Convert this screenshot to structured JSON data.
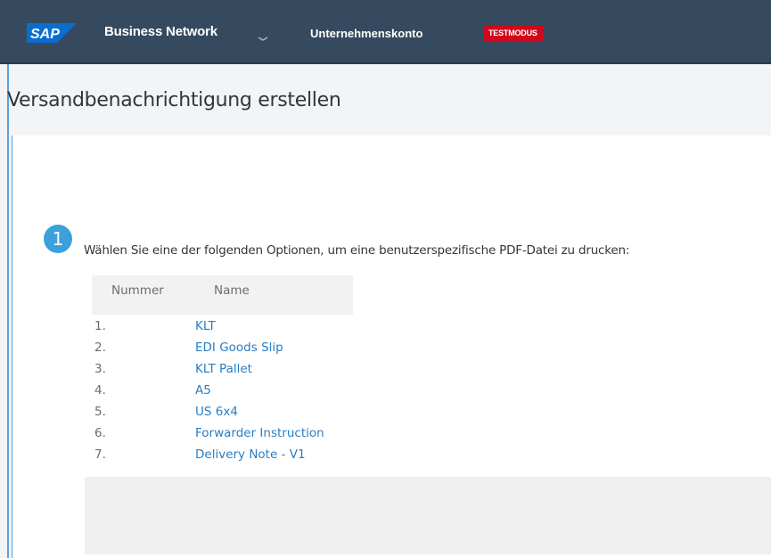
{
  "header": {
    "logo_text": "SAP",
    "app_name": "Business Network",
    "account_label": "Unternehmenskonto",
    "mode_badge": "TESTMODUS",
    "colors": {
      "bar": "#354a5f",
      "badge": "#d0081c",
      "logo": "#0a6ed1"
    }
  },
  "page": {
    "title": "Versandbenachrichtigung erstellen"
  },
  "step": {
    "number": "1",
    "instruction": "Wählen Sie eine der folgenden Optionen, um eine benutzerspezifische PDF-Datei zu drucken:"
  },
  "table": {
    "columns": [
      "Nummer",
      "Name"
    ],
    "rows": [
      {
        "num": "1.",
        "name": "KLT"
      },
      {
        "num": "2.",
        "name": "EDI Goods Slip"
      },
      {
        "num": "3.",
        "name": "KLT Pallet"
      },
      {
        "num": "4.",
        "name": "A5"
      },
      {
        "num": "5.",
        "name": "US 6x4"
      },
      {
        "num": "6.",
        "name": "Forwarder Instruction"
      },
      {
        "num": "7.",
        "name": "Delivery Note - V1"
      }
    ]
  }
}
